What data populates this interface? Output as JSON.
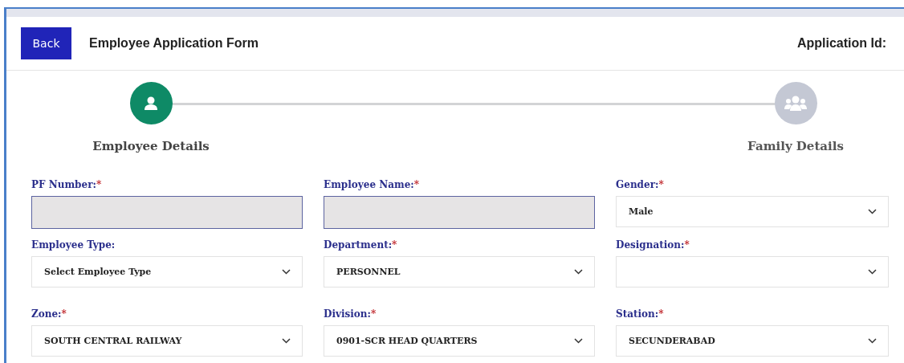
{
  "header": {
    "back_button": "Back",
    "title": "Employee Application Form",
    "application_id_label": "Application Id:"
  },
  "steps": [
    {
      "label": "Employee Details",
      "kind": "person",
      "active": true
    },
    {
      "label": "Family Details",
      "kind": "group",
      "active": false
    }
  ],
  "fields": [
    {
      "label": "PF Number:",
      "required_mark": "*",
      "kind": "text",
      "disabled": true
    },
    {
      "label": "Employee Name:",
      "required_mark": "*",
      "kind": "text",
      "disabled": true
    },
    {
      "label": "Gender:",
      "required_mark": "*",
      "kind": "select",
      "value": "Male"
    },
    {
      "label": "Employee Type:",
      "kind": "select",
      "value": "Select Employee Type"
    },
    {
      "label": "Department:",
      "required_mark": "*",
      "kind": "select",
      "value": "PERSONNEL"
    },
    {
      "label": "Designation:",
      "required_mark": "*",
      "kind": "select"
    },
    {
      "label": "Zone:",
      "required_mark": "*",
      "kind": "select",
      "value": "SOUTH CENTRAL RAILWAY"
    },
    {
      "label": "Division:",
      "required_mark": "*",
      "kind": "select",
      "value": "0901-SCR HEAD QUARTERS"
    },
    {
      "label": "Station:",
      "required_mark": "*",
      "kind": "select",
      "value": "SECUNDERABAD"
    }
  ]
}
